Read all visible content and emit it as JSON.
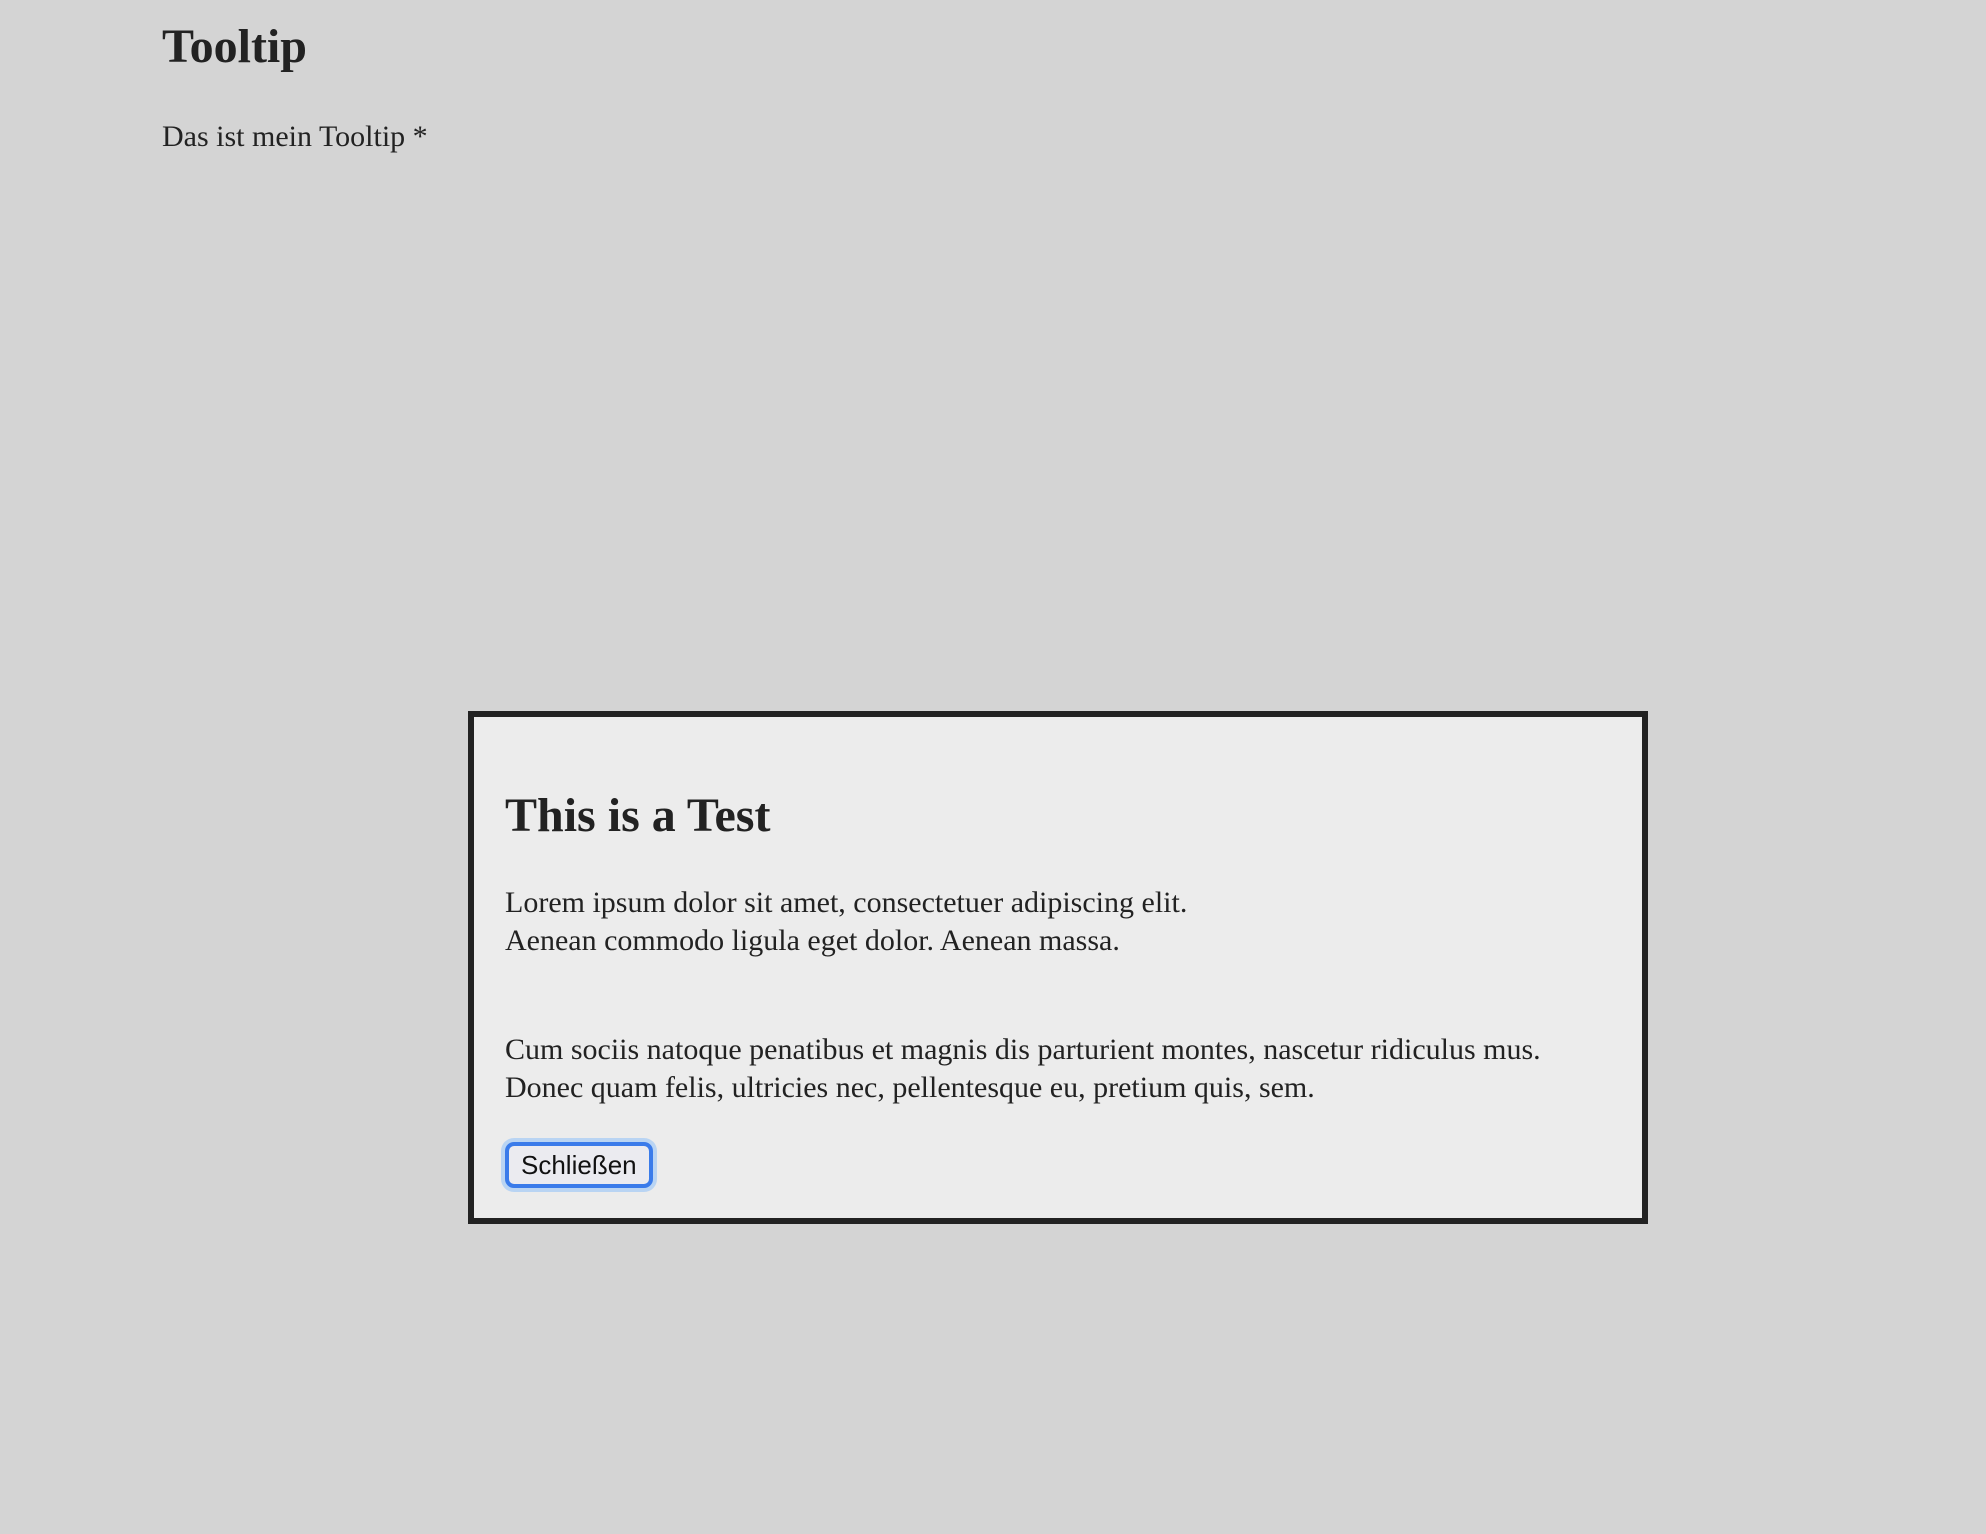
{
  "page": {
    "title": "Tooltip",
    "text": "Das ist mein Tooltip *"
  },
  "dialog": {
    "heading": "This is a Test",
    "paragraph1": {
      "line1": "Lorem ipsum dolor sit amet, consectetuer adipiscing elit.",
      "line2": "Aenean commodo ligula eget dolor. Aenean massa."
    },
    "paragraph2": {
      "line1": "Cum sociis natoque penatibus et magnis dis parturient montes, nascetur ridiculus mus.",
      "line2": "Donec quam felis, ultricies nec, pellentesque eu, pretium quis, sem."
    },
    "close_label": "Schließen"
  }
}
